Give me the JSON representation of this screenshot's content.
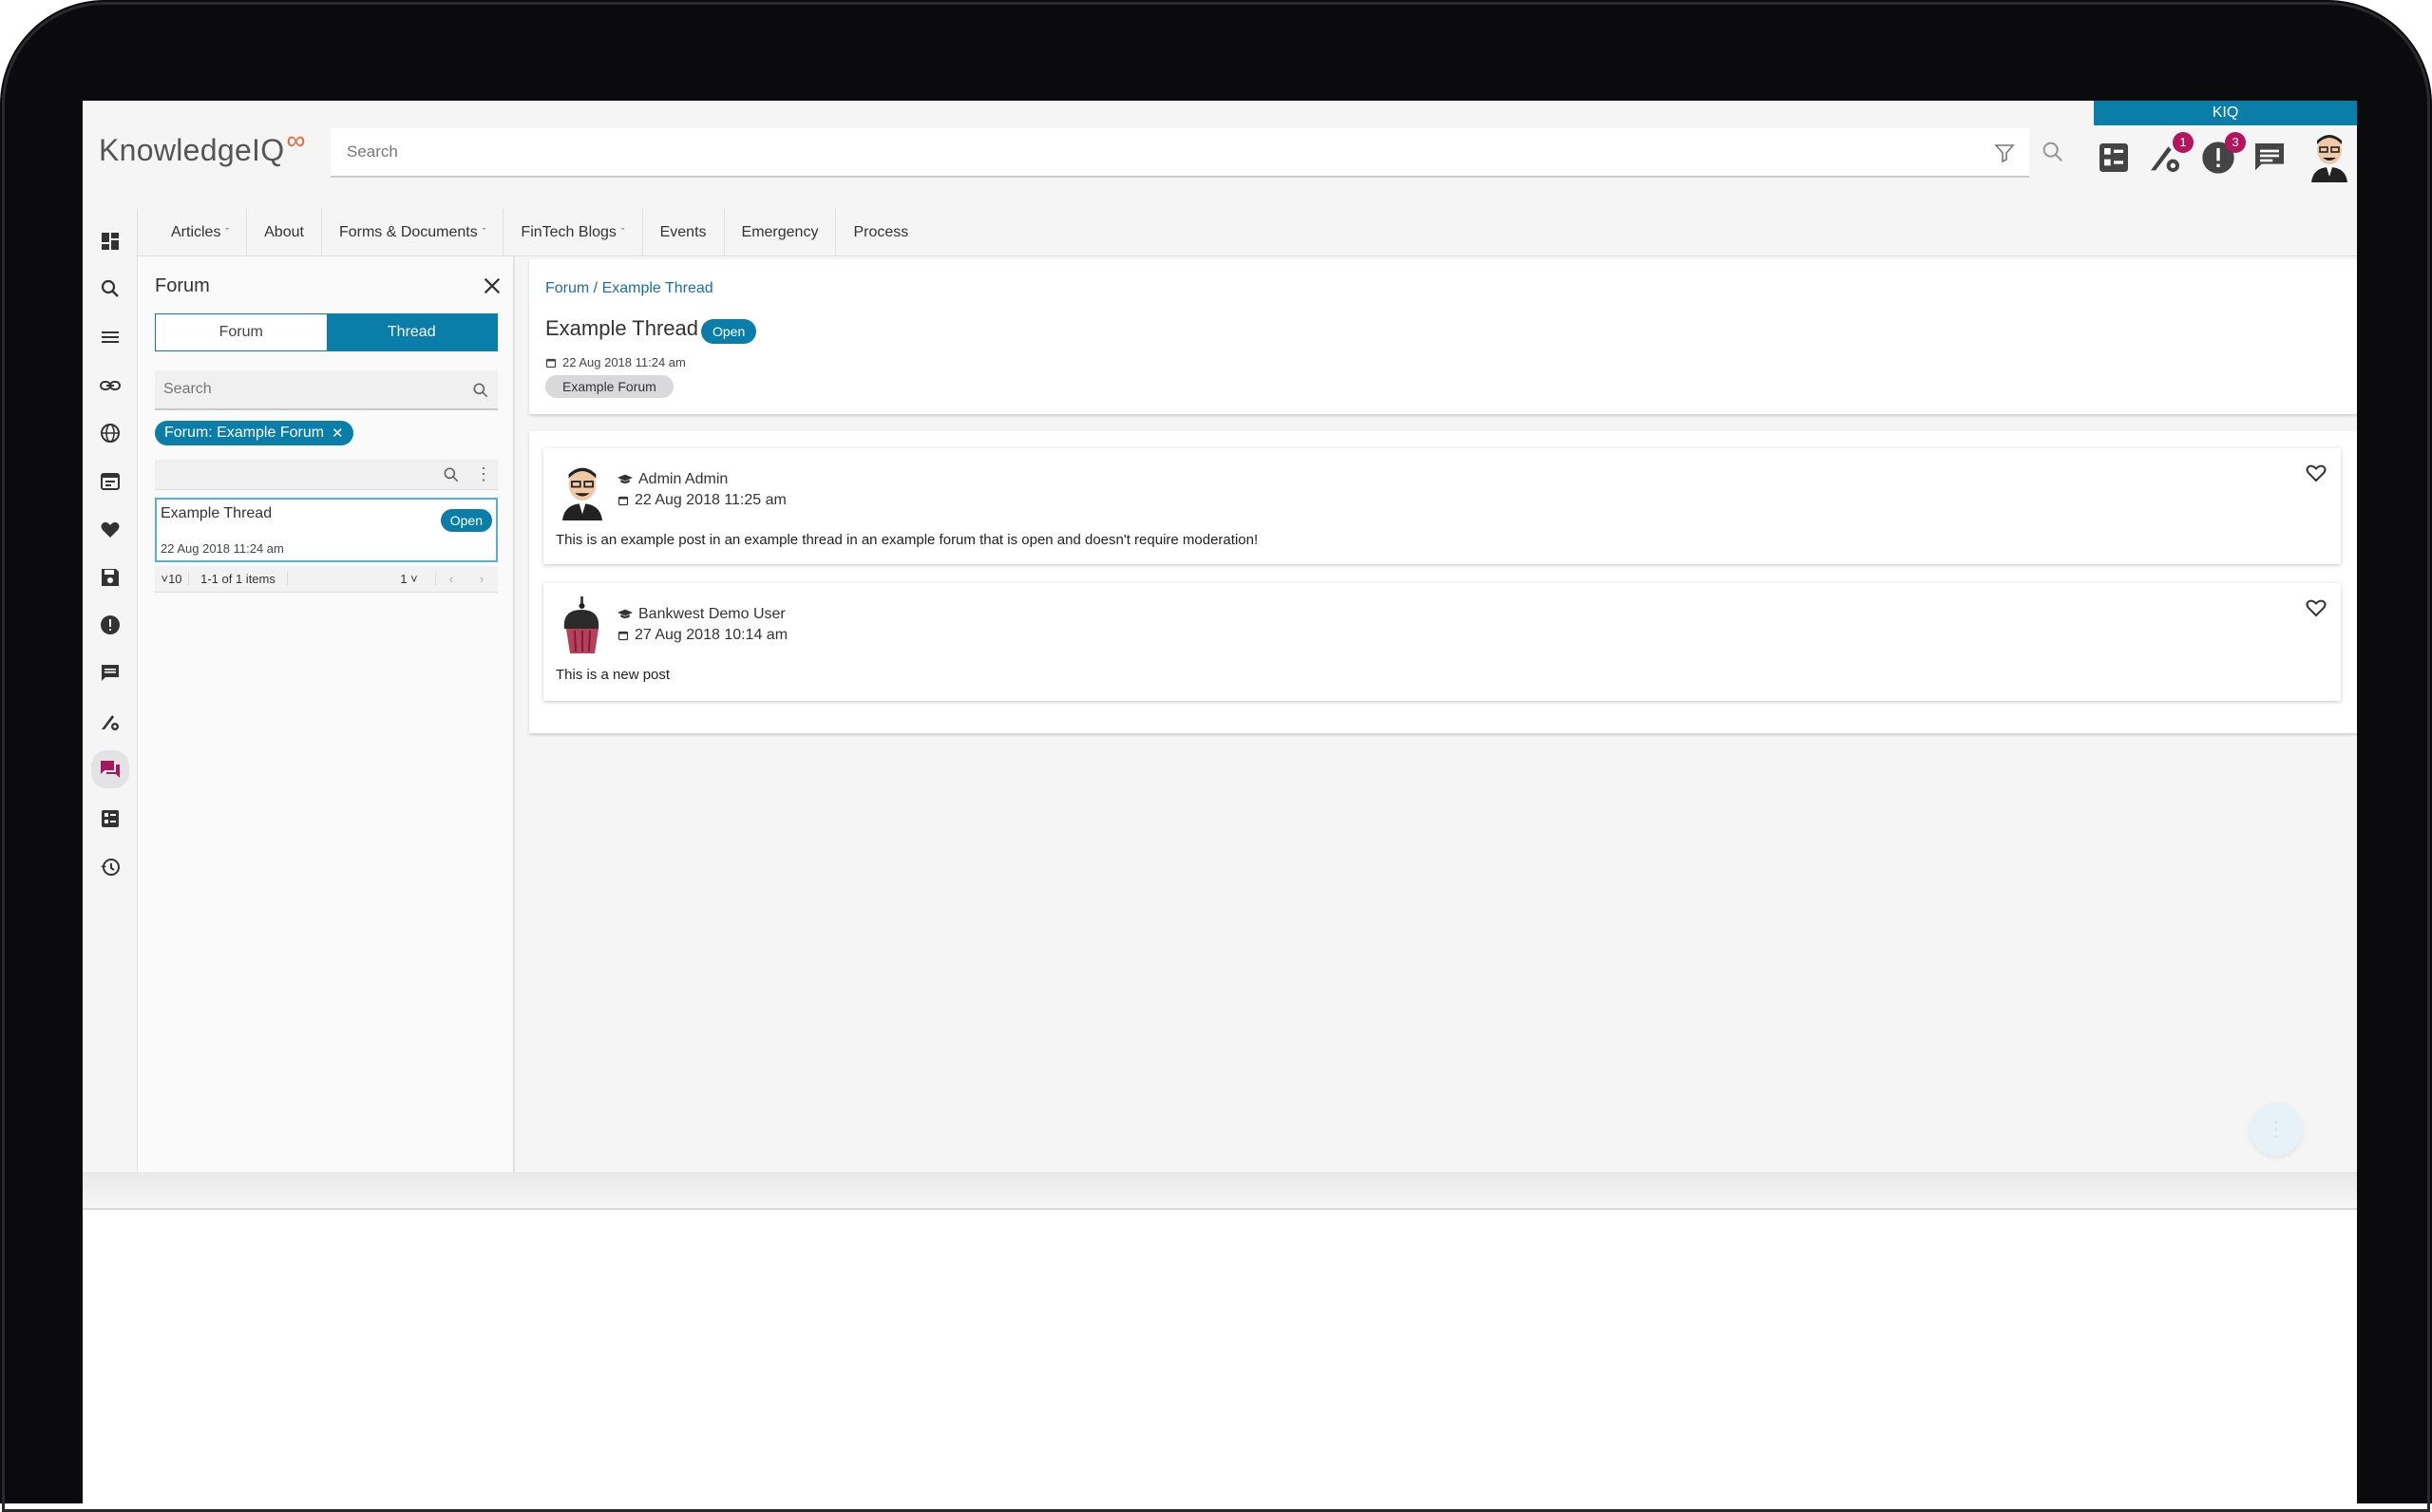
{
  "header": {
    "logo_text": "KnowledgeIQ",
    "search_placeholder": "Search",
    "kiq_tab": "KIQ",
    "notifications_badge": "1",
    "alerts_badge": "3"
  },
  "nav": {
    "items": [
      {
        "label": "Articles",
        "dropdown": true
      },
      {
        "label": "About",
        "dropdown": false
      },
      {
        "label": "Forms & Documents",
        "dropdown": true
      },
      {
        "label": "FinTech Blogs",
        "dropdown": true
      },
      {
        "label": "Events",
        "dropdown": false
      },
      {
        "label": "Emergency",
        "dropdown": false
      },
      {
        "label": "Process",
        "dropdown": false
      }
    ]
  },
  "rail": {
    "icons": [
      "dashboard-icon",
      "search-icon",
      "menu-icon",
      "link-icon",
      "globe-icon",
      "calendar-icon",
      "heart-icon",
      "save-icon",
      "alert-icon",
      "comment-icon",
      "tools-icon",
      "forum-icon",
      "list-icon",
      "history-icon"
    ],
    "active": "forum-icon"
  },
  "panel": {
    "title": "Forum",
    "toggle_forum": "Forum",
    "toggle_thread": "Thread",
    "search_placeholder": "Search",
    "filter_chip": "Forum: Example Forum",
    "thread": {
      "title": "Example Thread",
      "date": "22 Aug 2018 11:24 am",
      "status": "Open"
    },
    "pager": {
      "page_size": "10",
      "info": "1-1 of 1 items",
      "page": "1"
    }
  },
  "main": {
    "breadcrumb": "Forum / Example Thread",
    "title": "Example Thread",
    "status": "Open",
    "date": "22 Aug 2018 11:24 am",
    "forum_tag": "Example Forum",
    "posts": [
      {
        "author": "Admin Admin",
        "date": "22 Aug 2018 11:25 am",
        "body": "This is an example post in an example thread in an example forum that is open and doesn't require moderation!"
      },
      {
        "author": "Bankwest Demo User",
        "date": "27 Aug 2018 10:14 am",
        "body": "This is a new post"
      }
    ]
  },
  "colors": {
    "accent": "#0a7da8",
    "badge": "#b5135c",
    "logo_mark": "#e6683c"
  }
}
